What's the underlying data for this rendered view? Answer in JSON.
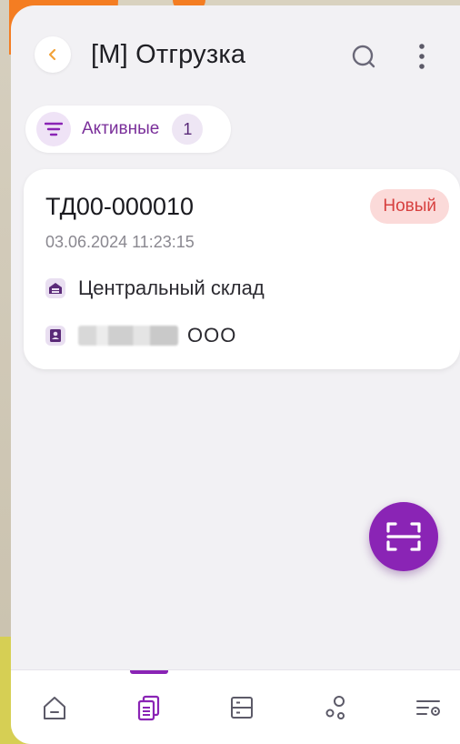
{
  "header": {
    "title": "[M] Отгрузка"
  },
  "filter": {
    "label": "Активные",
    "count": "1"
  },
  "documents": [
    {
      "number": "ТД00-000010",
      "status": "Новый",
      "datetime": "03.06.2024 11:23:15",
      "warehouse": "Центральный склад",
      "contractor_suffix": "ООО"
    }
  ],
  "icons": {
    "back": "chevron-left-icon",
    "search": "search-icon",
    "more": "more-vertical-icon",
    "filter": "filter-icon",
    "warehouse": "warehouse-icon",
    "contractor": "contact-card-icon",
    "scan": "scan-icon",
    "nav": [
      "home-icon",
      "documents-icon",
      "storage-icon",
      "connections-icon",
      "settings-list-icon"
    ]
  },
  "colors": {
    "accent": "#8a24b5",
    "status_bg": "#fbdad9",
    "status_text": "#d7403f",
    "back_arrow": "#f2a23a"
  },
  "bottom_nav": {
    "active_index": 1
  }
}
